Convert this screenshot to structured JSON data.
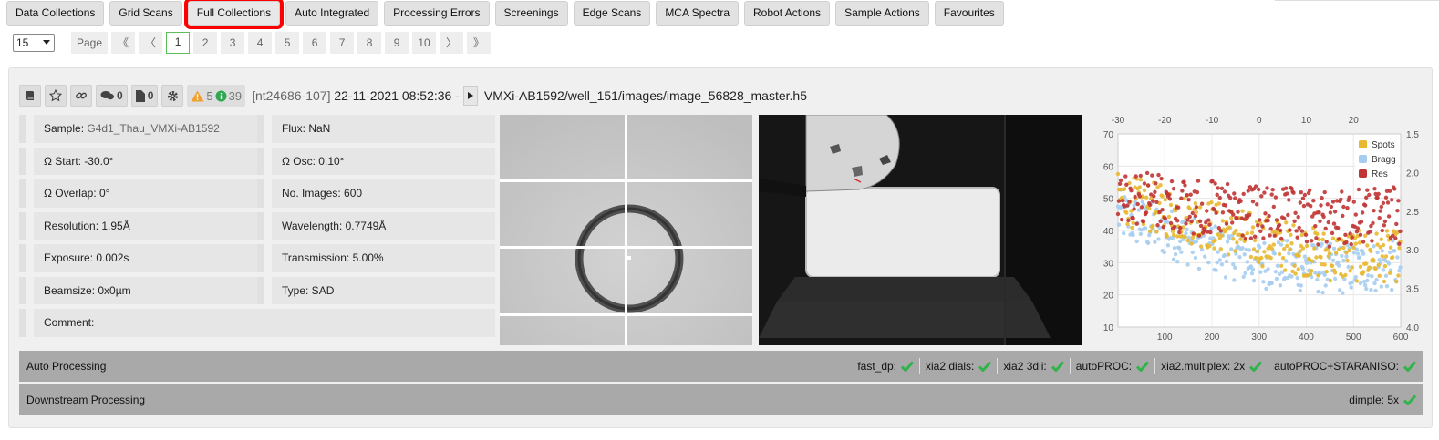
{
  "tabs": [
    {
      "label": "Data Collections"
    },
    {
      "label": "Grid Scans"
    },
    {
      "label": "Full Collections",
      "active": true
    },
    {
      "label": "Auto Integrated"
    },
    {
      "label": "Processing Errors"
    },
    {
      "label": "Screenings"
    },
    {
      "label": "Edge Scans"
    },
    {
      "label": "MCA Spectra"
    },
    {
      "label": "Robot Actions"
    },
    {
      "label": "Sample Actions"
    },
    {
      "label": "Favourites"
    }
  ],
  "pagination": {
    "per_page": "15",
    "label": "Page",
    "first": "《",
    "prev": "〈",
    "pages": [
      "1",
      "2",
      "3",
      "4",
      "5",
      "6",
      "7",
      "8",
      "9",
      "10"
    ],
    "current": "1",
    "next": "〉",
    "last": "》"
  },
  "collection": {
    "comments_count": "0",
    "attachments_count": "0",
    "warnings": "5",
    "info": "39",
    "visit": "[nt24686-107]",
    "datetime": "22-11-2021 08:52:36 -",
    "path": "VMXi-AB1592/well_151/images/image_56828_master.h5"
  },
  "params": {
    "sample_label": "Sample:",
    "sample_value": "G4d1_Thau_VMXi-AB1592",
    "flux": "Flux: NaN",
    "omega_start": "Ω Start: -30.0°",
    "omega_osc": "Ω Osc: 0.10°",
    "omega_overlap": "Ω Overlap: 0°",
    "num_images": "No. Images: 600",
    "resolution": "Resolution: 1.95Å",
    "wavelength": "Wavelength: 0.7749Å",
    "exposure": "Exposure: 0.002s",
    "transmission": "Transmission: 5.00%",
    "beamsize": "Beamsize: 0x0µm",
    "type": "Type: SAD",
    "comment": "Comment:"
  },
  "auto_processing": {
    "label": "Auto Processing",
    "items": [
      "fast_dp:",
      "xia2 dials:",
      "xia2 3dii:",
      "autoPROC:",
      "xia2.multiplex: 2x",
      "autoPROC+STARANISO:"
    ]
  },
  "downstream": {
    "label": "Downstream Processing",
    "items": [
      "dimple: 5x"
    ]
  },
  "colors": {
    "spots": "#e8b830",
    "bragg": "#a6cdef",
    "res": "#c03434",
    "check": "#2fb34a",
    "highlight": "#ff0000"
  },
  "chart_data": {
    "type": "scatter",
    "x_bottom_ticks": [
      "100",
      "200",
      "300",
      "400",
      "500",
      "600"
    ],
    "x_top_ticks": [
      "-30",
      "-20",
      "-10",
      "0",
      "10",
      "20"
    ],
    "y_left_ticks": [
      "70",
      "60",
      "50",
      "40",
      "30",
      "20",
      "10"
    ],
    "y_right_ticks": [
      "1.5",
      "2.0",
      "2.5",
      "3.0",
      "3.5",
      "4.0"
    ],
    "xlim": [
      1,
      600
    ],
    "ylim": [
      10,
      70
    ],
    "y2lim": [
      1.5,
      4.0
    ],
    "legend_position": "top-right",
    "series": [
      {
        "name": "Spots",
        "trend": [
          [
            1,
            50
          ],
          [
            150,
            44
          ],
          [
            300,
            37
          ],
          [
            450,
            32
          ],
          [
            600,
            32
          ]
        ]
      },
      {
        "name": "Bragg",
        "trend": [
          [
            1,
            45
          ],
          [
            150,
            37
          ],
          [
            300,
            30
          ],
          [
            450,
            28
          ],
          [
            600,
            29
          ]
        ]
      },
      {
        "name": "Res",
        "trend": [
          [
            1,
            2.25
          ],
          [
            150,
            2.45
          ],
          [
            300,
            2.55
          ],
          [
            450,
            2.6
          ],
          [
            600,
            2.55
          ]
        ]
      }
    ]
  }
}
